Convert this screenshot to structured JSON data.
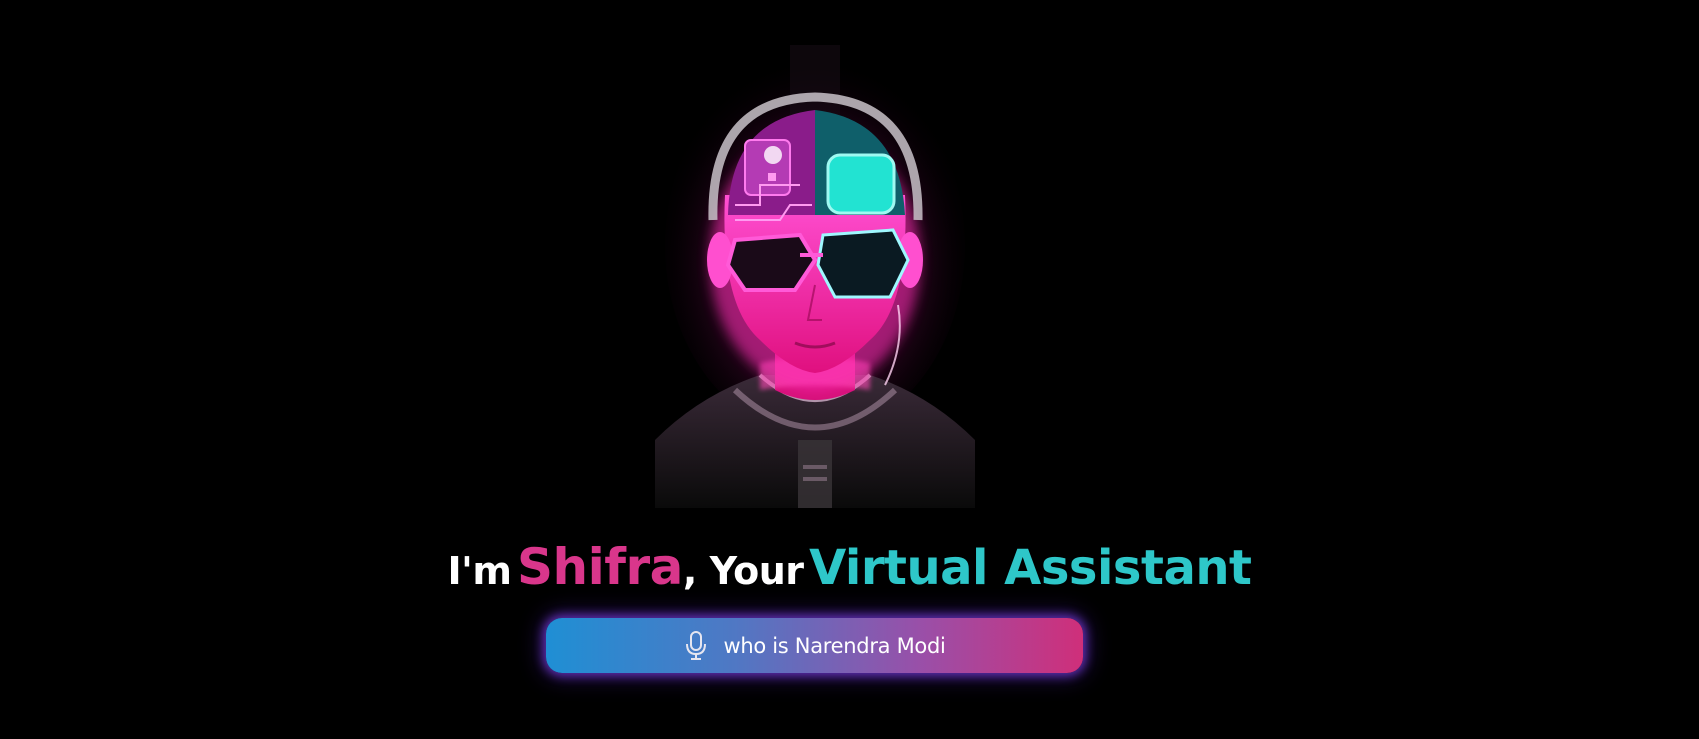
{
  "headline": {
    "intro": "I'm",
    "name": "Shifra",
    "separator": ", Your",
    "role": "Virtual Assistant"
  },
  "voice_button": {
    "icon": "microphone-icon",
    "label": "who is Narendra Modi"
  },
  "avatar": {
    "icon": "neon-cyborg-avatar"
  },
  "colors": {
    "background": "#000000",
    "name_accent": "#d9368b",
    "role_accent": "#2ec7c9",
    "button_gradient_start": "#1f8fd4",
    "button_gradient_end": "#cf2f7a",
    "glow": "#7a3cdc"
  }
}
